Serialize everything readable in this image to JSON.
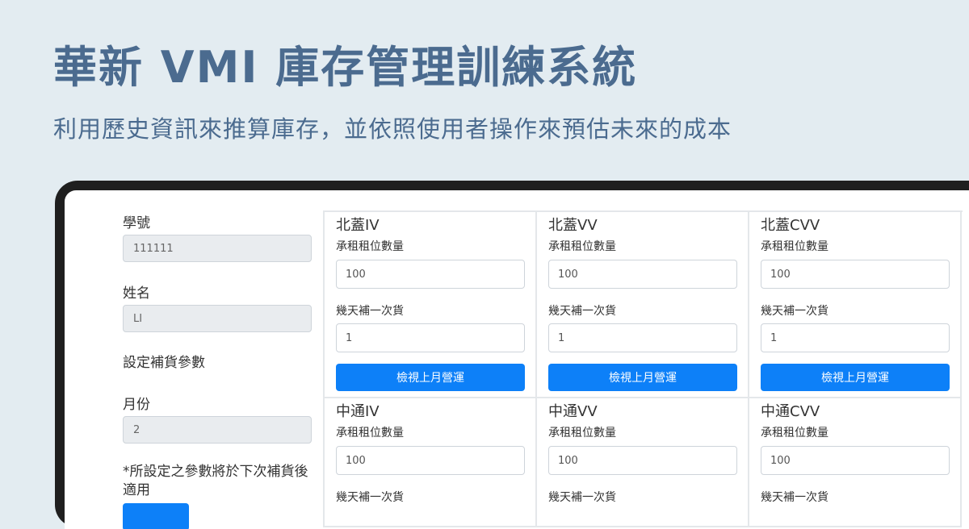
{
  "hero": {
    "title": "華新 VMI 庫存管理訓練系統",
    "subtitle": "利用歷史資訊來推算庫存，並依照使用者操作來預估未來的成本"
  },
  "form": {
    "student_id_label": "學號",
    "student_id_value": "111111",
    "name_label": "姓名",
    "name_value": "LI",
    "settings_heading": "設定補貨參數",
    "month_label": "月份",
    "month_value": "2",
    "note": "*所設定之參數將於下次補貨後適用"
  },
  "cards": [
    {
      "title": "北蓋IV",
      "rent_label": "承租租位數量",
      "rent_value": "100",
      "days_label": "幾天補一次貨",
      "days_value": "1",
      "button": "檢視上月營運"
    },
    {
      "title": "北蓋VV",
      "rent_label": "承租租位數量",
      "rent_value": "100",
      "days_label": "幾天補一次貨",
      "days_value": "1",
      "button": "檢視上月營運"
    },
    {
      "title": "北蓋CVV",
      "rent_label": "承租租位數量",
      "rent_value": "100",
      "days_label": "幾天補一次貨",
      "days_value": "1",
      "button": "檢視上月營運"
    },
    {
      "title": "中通IV",
      "rent_label": "承租租位數量",
      "rent_value": "100",
      "days_label": "幾天補一次貨"
    },
    {
      "title": "中通VV",
      "rent_label": "承租租位數量",
      "rent_value": "100",
      "days_label": "幾天補一次貨"
    },
    {
      "title": "中通CVV",
      "rent_label": "承租租位數量",
      "rent_value": "100",
      "days_label": "幾天補一次貨"
    }
  ],
  "colors": {
    "background": "#e3ecf1",
    "title": "#4b6b8f",
    "primary_button": "#0d80f8",
    "device_frame": "#1f1f1f"
  }
}
